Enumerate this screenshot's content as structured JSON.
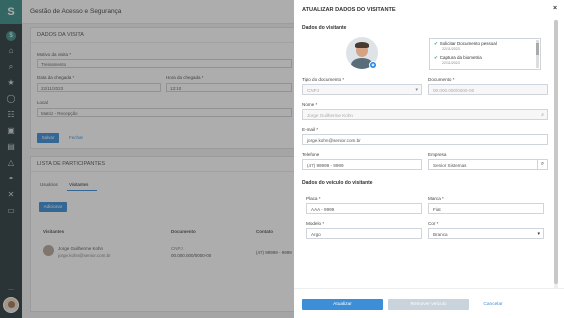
{
  "rail": {
    "logo": "S",
    "icons": [
      "home-icon",
      "search-icon",
      "star-icon",
      "shield-icon",
      "people-icon",
      "briefcase-icon",
      "badge-icon",
      "building-icon",
      "gauge-icon",
      "close-x-icon",
      "monitor-icon"
    ],
    "more": "..."
  },
  "page": {
    "title": "Gestão de Acesso e Segurança",
    "visit_card_title": "DADOS DA VISITA",
    "reason_label": "Motivo da visita *",
    "reason_value": "Treinamento",
    "arrival_date_label": "Data da chegada *",
    "arrival_date_value": "22/11/2023",
    "arrival_time_label": "Hora da chegada *",
    "arrival_time_value": "13:10",
    "location_label": "Local",
    "location_value": "Matriz - Recepção",
    "save_label": "Salvar",
    "close_label": "Fechar",
    "participants_title": "LISTA DE PARTICIPANTES",
    "tab_users": "Usuários",
    "tab_visitors": "Visitantes",
    "add_label": "Adicionar",
    "col_visitors": "Visitantes",
    "col_document": "Documento",
    "col_contact": "Contato",
    "row_name": "Jorge Guilherme Kohn",
    "row_email": "jorge.kohn@senior.com.br",
    "row_doc_type": "CNPJ",
    "row_doc_value": "00.000.000/0000-00",
    "row_contact": "(47) 99999 - 9999"
  },
  "modal": {
    "title": "ATUALIZAR DADOS DO VISITANTE",
    "close": "×",
    "visitor_section": "Dados do visitante",
    "steps": [
      {
        "label": "Solicitar Documento pessoal",
        "time": "22/11/2023"
      },
      {
        "label": "Captura da biometria",
        "time": "22/11/2023"
      }
    ],
    "doc_type_label": "Tipo do documento *",
    "doc_type_value": "CNPJ",
    "doc_label": "Documento *",
    "doc_value": "00.000.000/0000-00",
    "name_label": "Nome *",
    "name_value": "Jorge Guilherme Kohn",
    "email_label": "E-mail *",
    "email_value": "jorge.kohn@senior.com.br",
    "phone_label": "Telefone",
    "phone_value": "(47) 99999 - 9999",
    "company_label": "Empresa",
    "company_value": "Senior Sistemas",
    "vehicle_section": "Dados do veículo do visitante",
    "plate_label": "Placa *",
    "plate_value": "AAA - 9999",
    "brand_label": "Marca *",
    "brand_value": "Fiat",
    "model_label": "Modelo *",
    "model_value": "Argo",
    "color_label": "Cor *",
    "color_value": "Branca",
    "update_label": "Atualizar",
    "remove_vehicle_label": "Remover veículo",
    "cancel_label": "Cancelar"
  },
  "colors": {
    "accent": "#3c8fd6",
    "rail": "#2d3a3f",
    "brand": "#3c8f8a",
    "success": "#2e9e5b"
  }
}
